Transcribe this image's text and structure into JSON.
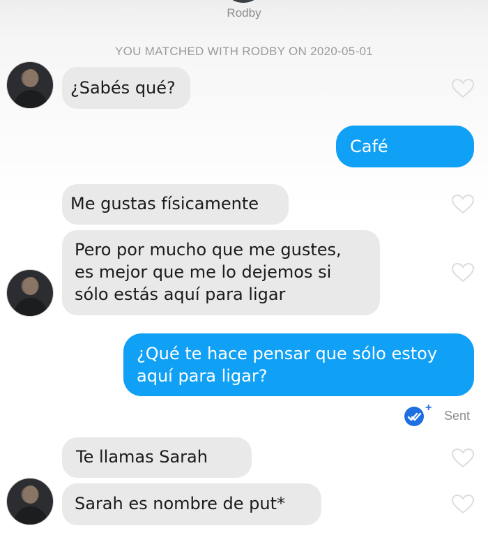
{
  "header": {
    "name": "Rodby",
    "match_banner": "YOU MATCHED WITH RODBY ON 2020-05-01"
  },
  "messages": [
    {
      "from": "Rodby",
      "text": "¿Sabés qué?"
    },
    {
      "from": "me",
      "text": "Café"
    },
    {
      "from": "Rodby",
      "text": "Me gustas físicamente"
    },
    {
      "from": "Rodby",
      "lines": [
        "Pero por mucho que me gustes,",
        "es mejor que me lo dejemos si",
        "sólo estás aquí para ligar"
      ]
    },
    {
      "from": "me",
      "lines": [
        "¿Qué te hace pensar que sólo estoy",
        "aquí para ligar?"
      ]
    },
    {
      "from": "Rodby",
      "text": "Te llamas Sarah"
    },
    {
      "from": "Rodby",
      "text": "Sarah es nombre de put*"
    }
  ],
  "status": {
    "icon": "double-check-icon",
    "plus": "+",
    "label": "Sent"
  },
  "colors": {
    "outgoing_bubble": "#10a0f5",
    "incoming_bubble": "#e9e9e9",
    "sent_icon": "#1f6fe0"
  }
}
